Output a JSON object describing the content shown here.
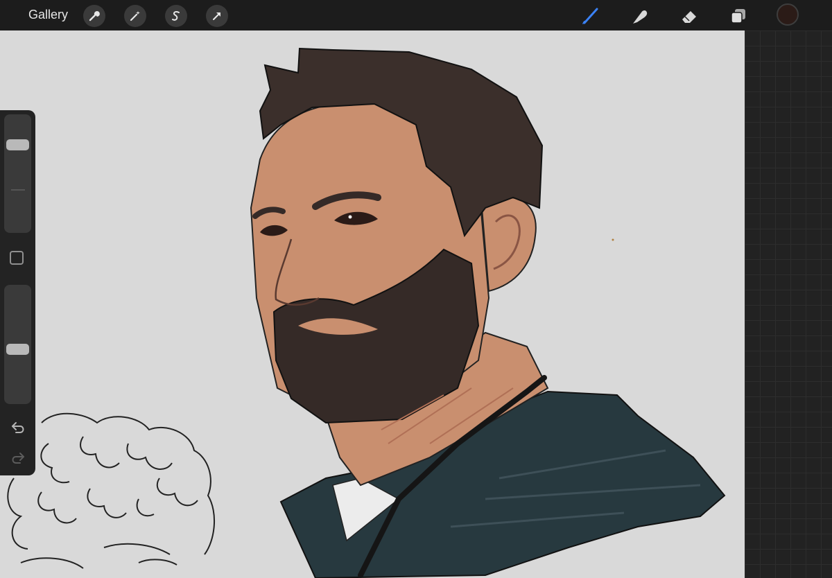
{
  "app": {
    "gallery_label": "Gallery"
  },
  "toolbar_left": [
    {
      "name": "actions",
      "icon": "wrench-icon"
    },
    {
      "name": "adjustments",
      "icon": "magic-wand-icon"
    },
    {
      "name": "selection",
      "icon": "selection-s-icon"
    },
    {
      "name": "transform",
      "icon": "arrow-cursor-icon"
    }
  ],
  "toolbar_right": [
    {
      "name": "brush",
      "icon": "brush-icon",
      "active": true
    },
    {
      "name": "smudge",
      "icon": "smudge-finger-icon",
      "active": false
    },
    {
      "name": "eraser",
      "icon": "eraser-icon",
      "active": false
    },
    {
      "name": "layers",
      "icon": "layers-icon",
      "active": false
    }
  ],
  "colors": {
    "current_color": "#2b1b17",
    "active_tool": "#3b82f6",
    "canvas_bg": "#d9d9d9",
    "skin": "#c98f6f",
    "hair": "#3b2f2b",
    "shirt": "#27393f"
  },
  "sidebar": {
    "brush_size_level": 0.2,
    "opacity_level": 0.55,
    "modifier_icon": "square-modifier-icon",
    "undo_icon": "undo-icon",
    "redo_icon": "redo-icon"
  }
}
